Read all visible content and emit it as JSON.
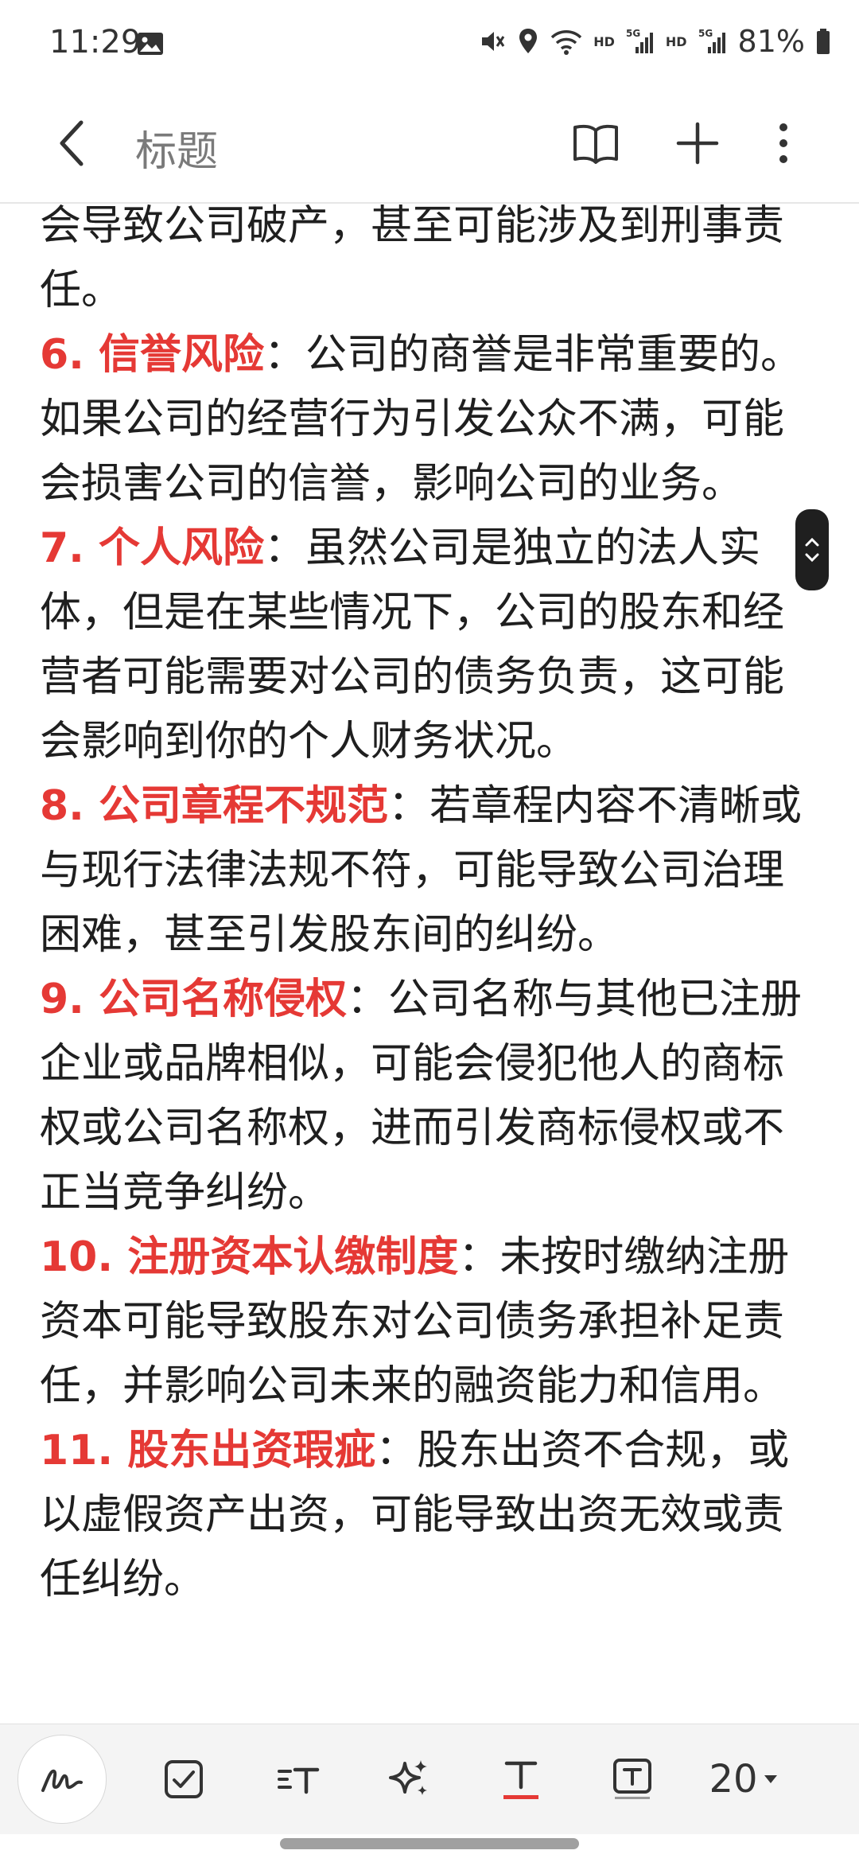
{
  "status_bar": {
    "time": "11:29",
    "network_label": "HD",
    "signal_label": "5G",
    "battery": "81%"
  },
  "app_bar": {
    "title": "标题",
    "icons": [
      "back-icon",
      "reader-mode-icon",
      "add-icon",
      "more-options-icon"
    ]
  },
  "content": {
    "paragraphs": [
      {
        "prefix": "",
        "highlight": "",
        "text": "会导致公司破产，甚至可能涉及到刑事责任。"
      },
      {
        "prefix": "",
        "highlight": "6. 信誉风险",
        "text": "：公司的商誉是非常重要的。如果公司的经营行为引发公众不满，可能会损害公司的信誉，影响公司的业务。"
      },
      {
        "prefix": "",
        "highlight": "7. 个人风险",
        "text": "：虽然公司是独立的法人实体，但是在某些情况下，公司的股东和经营者可能需要对公司的债务负责，这可能会影响到你的个人财务状况。"
      },
      {
        "prefix": "",
        "highlight": "8. 公司章程不规范",
        "text": "：若章程内容不清晰或与现行法律法规不符，可能导致公司治理困难，甚至引发股东间的纠纷。"
      },
      {
        "prefix": "",
        "highlight": "9. 公司名称侵权",
        "text": "：公司名称与其他已注册企业或品牌相似，可能会侵犯他人的商标权或公司名称权，进而引发商标侵权或不正当竞争纠纷。"
      },
      {
        "prefix": "",
        "highlight": "10. 注册资本认缴制度",
        "text": "：未按时缴纳注册资本可能导致股东对公司债务承担补足责任，并影响公司未来的融资能力和信用。"
      },
      {
        "prefix": "",
        "highlight": "11. 股东出资瑕疵",
        "text": "：股东出资不合规，或以虚假资产出资，可能导致出资无效或责任纠纷。"
      }
    ],
    "highlight_color": "#e53935"
  },
  "toolbar": {
    "tools": [
      "handwriting-icon",
      "checklist-icon",
      "paragraph-style-icon",
      "ai-assist-icon",
      "text-format-icon",
      "text-box-icon"
    ],
    "font_size": "20"
  }
}
